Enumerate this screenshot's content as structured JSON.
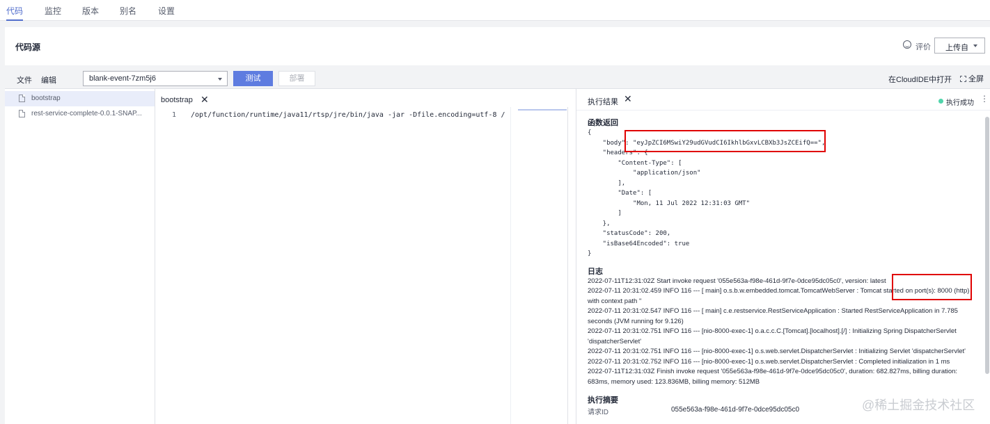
{
  "top_tabs": [
    "代码",
    "监控",
    "版本",
    "别名",
    "设置"
  ],
  "header": {
    "title": "代码源",
    "rate_label": "评价",
    "upload_label": "上传自"
  },
  "toolbar": {
    "file_menu": "文件",
    "edit_menu": "编辑",
    "function_select": "blank-event-7zm5j6",
    "test_label": "测试",
    "deploy_label": "部署",
    "cloudide_label": "在CloudIDE中打开",
    "fullscreen_label": "全屏"
  },
  "file_tree": [
    "bootstrap",
    "rest-service-complete-0.0.1-SNAP..."
  ],
  "editor": {
    "tab_label": "bootstrap",
    "line_number": "1",
    "code": "/opt/function/runtime/java11/rtsp/jre/bin/java -jar -Dfile.encoding=utf-8 /"
  },
  "result": {
    "tab_label": "执行结果",
    "status": "执行成功",
    "return_title": "函数返回",
    "json_lines": [
      "{",
      "    \"body\": \"eyJpZCI6MSwiY29udGVudCI6IkhlbGxvLCBXb3JsZCEifQ==\",",
      "    \"headers\": {",
      "        \"Content-Type\": [",
      "            \"application/json\"",
      "        ],",
      "        \"Date\": [",
      "            \"Mon, 11 Jul 2022 12:31:03 GMT\"",
      "        ]",
      "    },",
      "    \"statusCode\": 200,",
      "    \"isBase64Encoded\": true",
      "}"
    ],
    "log_title": "日志",
    "log_lines": [
      "2022-07-11T12:31:02Z Start invoke request '055e563a-f98e-461d-9f7e-0dce95dc05c0', version: latest",
      "2022-07-11 20:31:02.459 INFO 116 --- [ main] o.s.b.w.embedded.tomcat.TomcatWebServer : Tomcat started on port(s): 8000 (http)",
      "with context path ''",
      "2022-07-11 20:31:02.547 INFO 116 --- [ main] c.e.restservice.RestServiceApplication : Started RestServiceApplication in 7.785",
      "seconds (JVM running for 9.126)",
      "2022-07-11 20:31:02.751 INFO 116 --- [nio-8000-exec-1] o.a.c.c.C.[Tomcat].[localhost].[/] : Initializing Spring DispatcherServlet",
      "'dispatcherServlet'",
      "2022-07-11 20:31:02.751 INFO 116 --- [nio-8000-exec-1] o.s.web.servlet.DispatcherServlet : Initializing Servlet 'dispatcherServlet'",
      "2022-07-11 20:31:02.752 INFO 116 --- [nio-8000-exec-1] o.s.web.servlet.DispatcherServlet : Completed initialization in 1 ms",
      "2022-07-11T12:31:03Z Finish invoke request '055e563a-f98e-461d-9f7e-0dce95dc05c0', duration: 682.827ms, billing duration:",
      "683ms, memory used: 123.836MB, billing memory: 512MB"
    ],
    "summary_title": "执行摘要",
    "summary_key": "请求ID",
    "summary_val": "055e563a-f98e-461d-9f7e-0dce95dc05c0"
  },
  "watermark": "@稀土掘金技术社区",
  "colors": {
    "accent": "#526ecc",
    "test_button": "#5e7ce0",
    "highlight": "#e00000",
    "success": "#50d4ab"
  }
}
